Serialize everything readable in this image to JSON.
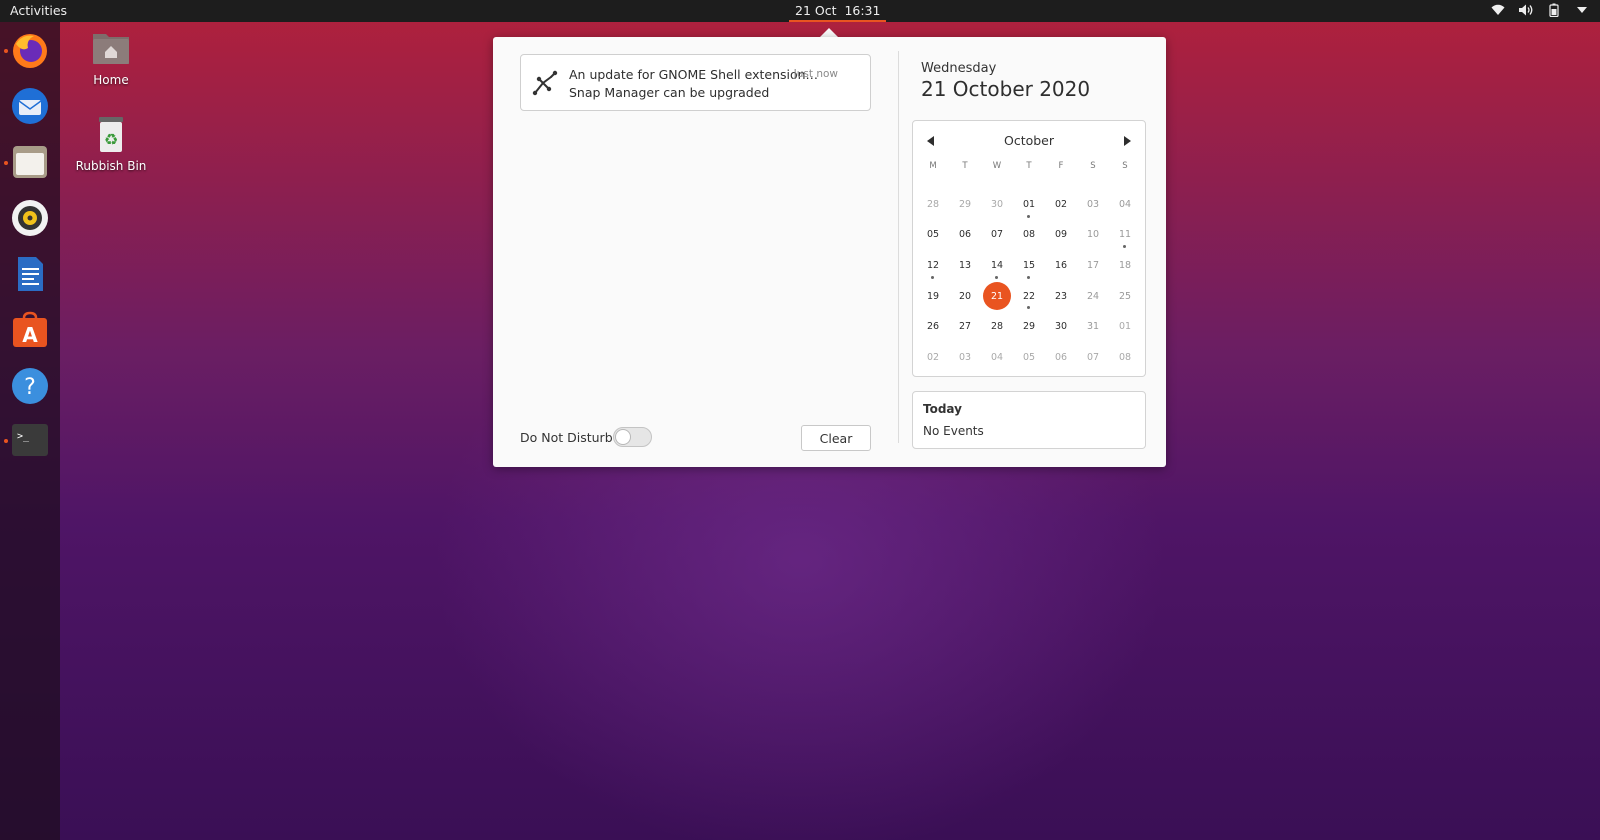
{
  "topbar": {
    "activities": "Activities",
    "clock": "21 Oct  16:31",
    "tray_icons": [
      "wifi-icon",
      "volume-icon",
      "battery-icon",
      "system-menu-chevron-icon"
    ]
  },
  "dock": {
    "apps": [
      {
        "name": "firefox",
        "icon": "firefox-icon",
        "running": true
      },
      {
        "name": "thunderbird",
        "icon": "thunderbird-icon",
        "running": false
      },
      {
        "name": "files",
        "icon": "files-icon",
        "running": true
      },
      {
        "name": "rhythmbox",
        "icon": "rhythmbox-icon",
        "running": false
      },
      {
        "name": "libreoffice-writer",
        "icon": "writer-icon",
        "running": false
      },
      {
        "name": "ubuntu-software",
        "icon": "software-icon",
        "running": false
      },
      {
        "name": "help",
        "icon": "help-icon",
        "running": false
      },
      {
        "name": "terminal",
        "icon": "terminal-icon",
        "running": true
      }
    ]
  },
  "desktop": {
    "home_label": "Home",
    "bin_label": "Rubbish Bin"
  },
  "notification": {
    "title": "An update for GNOME Shell extension…",
    "time": "Just now",
    "body": "Snap Manager can be upgraded"
  },
  "dnd": {
    "label": "Do Not Disturb",
    "enabled": false
  },
  "clear_label": "Clear",
  "date_header": {
    "weekday": "Wednesday",
    "date": "21 October 2020"
  },
  "calendar": {
    "month": "October",
    "weekdays": [
      "M",
      "T",
      "W",
      "T",
      "F",
      "S",
      "S"
    ],
    "weeks": [
      [
        "28",
        "29",
        "30",
        "01",
        "02",
        "03",
        "04"
      ],
      [
        "05",
        "06",
        "07",
        "08",
        "09",
        "10",
        "11"
      ],
      [
        "12",
        "13",
        "14",
        "15",
        "16",
        "17",
        "18"
      ],
      [
        "19",
        "20",
        "21",
        "22",
        "23",
        "24",
        "25"
      ],
      [
        "26",
        "27",
        "28",
        "29",
        "30",
        "31",
        "01"
      ],
      [
        "02",
        "03",
        "04",
        "05",
        "06",
        "07",
        "08"
      ]
    ],
    "today": "21"
  },
  "events": {
    "title": "Today",
    "body": "No Events"
  },
  "colors": {
    "accent": "#e95420",
    "topbar": "#1d1d1d"
  }
}
